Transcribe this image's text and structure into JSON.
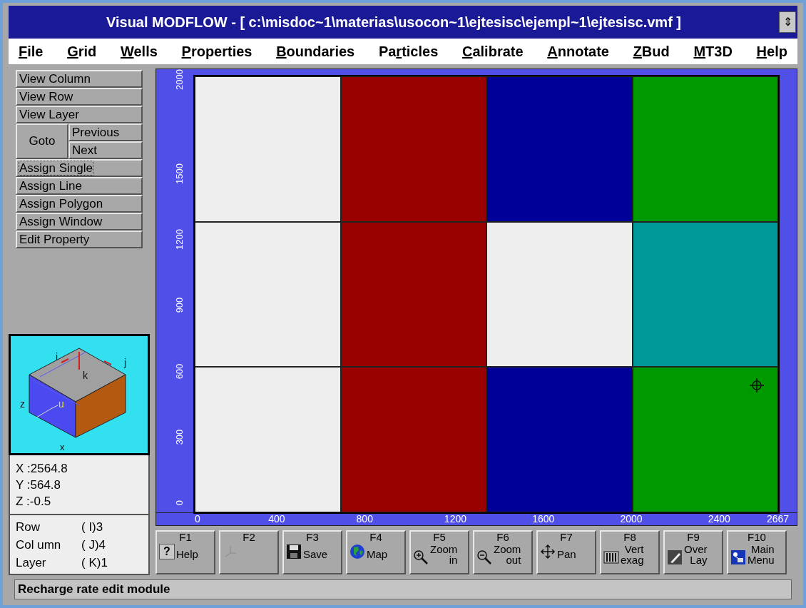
{
  "window": {
    "title": "Visual MODFLOW - [ c:\\misdoc~1\\materias\\usocon~1\\ejtesisc\\ejempl~1\\ejtesisc.vmf ]",
    "control": "⇕"
  },
  "menu": [
    {
      "key": "F",
      "after": "ile"
    },
    {
      "key": "G",
      "after": "rid"
    },
    {
      "key": "W",
      "after": "ells"
    },
    {
      "key": "P",
      "after": "roperties"
    },
    {
      "key": "B",
      "after": "oundaries"
    },
    {
      "before": "Pa",
      "key": "r",
      "after": "ticles"
    },
    {
      "key": "C",
      "after": "alibrate"
    },
    {
      "key": "A",
      "after": "nnotate"
    },
    {
      "key": "Z",
      "after": "Bud"
    },
    {
      "key": "M",
      "after": "T3D"
    },
    {
      "key": "H",
      "after": "elp"
    }
  ],
  "tools": [
    {
      "kind": "single",
      "label": "View Column",
      "focused": false
    },
    {
      "kind": "single",
      "label": "View Row",
      "focused": false
    },
    {
      "kind": "single",
      "label": "View Layer",
      "focused": false
    },
    {
      "kind": "goto",
      "label": "Goto",
      "previous": "Previous",
      "next": "Next"
    },
    {
      "kind": "single",
      "label": "Assign Single",
      "focused": true
    },
    {
      "kind": "single",
      "label": "Assign Line",
      "focused": false
    },
    {
      "kind": "single",
      "label": "Assign Polygon",
      "focused": false
    },
    {
      "kind": "single",
      "label": "Assign Window",
      "focused": false
    },
    {
      "kind": "single",
      "label": "Edit Property",
      "focused": false
    }
  ],
  "cube_labels": {
    "i": "i",
    "j": "j",
    "k": "k",
    "z": "z",
    "u": "u",
    "x": "x"
  },
  "coordinates": [
    "X :2564.8",
    "Y :564.8",
    "Z :-0.5"
  ],
  "position": [
    {
      "name": "Row",
      "value": "( I)3"
    },
    {
      "name": "Col umn",
      "value": "( J)4"
    },
    {
      "name": "Layer",
      "value": "( K)1"
    }
  ],
  "grid": {
    "rows": [
      {
        "cells": [
          {
            "color": "#eeeeee"
          },
          {
            "color": "#990000"
          },
          {
            "color": "#000099"
          },
          {
            "color": "#009900"
          }
        ]
      },
      {
        "cells": [
          {
            "color": "#eeeeee"
          },
          {
            "color": "#990000"
          },
          {
            "color": "#eeeeee"
          },
          {
            "color": "#009999"
          }
        ]
      },
      {
        "cells": [
          {
            "color": "#eeeeee"
          },
          {
            "color": "#990000"
          },
          {
            "color": "#000099"
          },
          {
            "color": "#009900"
          }
        ]
      }
    ],
    "x_axis": [
      "0",
      "400",
      "800",
      "1200",
      "1600",
      "2000",
      "2400",
      "2667"
    ],
    "y_axis": [
      "0",
      "300",
      "600",
      "900",
      "1200",
      "1500",
      "2000"
    ]
  },
  "function_keys": [
    {
      "key": "F1",
      "kind": "help",
      "symbol": "?",
      "caption": [
        "Help"
      ]
    },
    {
      "key": "F2",
      "kind": "axes"
    },
    {
      "key": "F3",
      "kind": "save",
      "caption": [
        "Save"
      ]
    },
    {
      "key": "F4",
      "kind": "globe",
      "caption": [
        "Map"
      ]
    },
    {
      "key": "F5",
      "kind": "zoomin",
      "caption": [
        "Zoom",
        "in"
      ]
    },
    {
      "key": "F6",
      "kind": "zoomout",
      "caption": [
        "Zoom",
        "out"
      ]
    },
    {
      "key": "F7",
      "kind": "pan",
      "caption": [
        "Pan"
      ]
    },
    {
      "key": "F8",
      "kind": "exag",
      "caption": [
        "Vert",
        "exag"
      ]
    },
    {
      "key": "F9",
      "kind": "overlay",
      "caption": [
        "Over",
        "Lay"
      ]
    },
    {
      "key": "F10",
      "kind": "menu",
      "caption": [
        "Main",
        "Menu"
      ]
    }
  ],
  "status_bar": "Recharge rate edit module"
}
